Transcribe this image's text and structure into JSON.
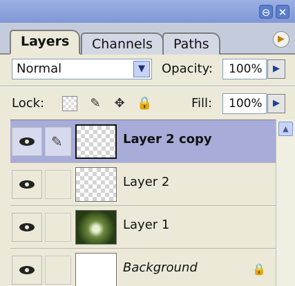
{
  "tabs": [
    {
      "label": "Layers",
      "active": true
    },
    {
      "label": "Channels",
      "active": false
    },
    {
      "label": "Paths",
      "active": false
    }
  ],
  "blend": {
    "mode": "Normal"
  },
  "opacity": {
    "label": "Opacity:",
    "value": "100%"
  },
  "lock": {
    "label": "Lock:"
  },
  "fill": {
    "label": "Fill:",
    "value": "100%"
  },
  "layers": [
    {
      "name": "Layer 2 copy",
      "selected": true,
      "thumbnail": "transparent",
      "visible": true
    },
    {
      "name": "Layer 2",
      "selected": false,
      "thumbnail": "transparent",
      "visible": true
    },
    {
      "name": "Layer 1",
      "selected": false,
      "thumbnail": "photo",
      "visible": true
    },
    {
      "name": "Background",
      "selected": false,
      "thumbnail": "white",
      "visible": true,
      "locked": true
    }
  ],
  "colors": {
    "selected_row": "#a8acd8",
    "titlebar": "#7f97d6",
    "panel": "#ece9d8"
  }
}
